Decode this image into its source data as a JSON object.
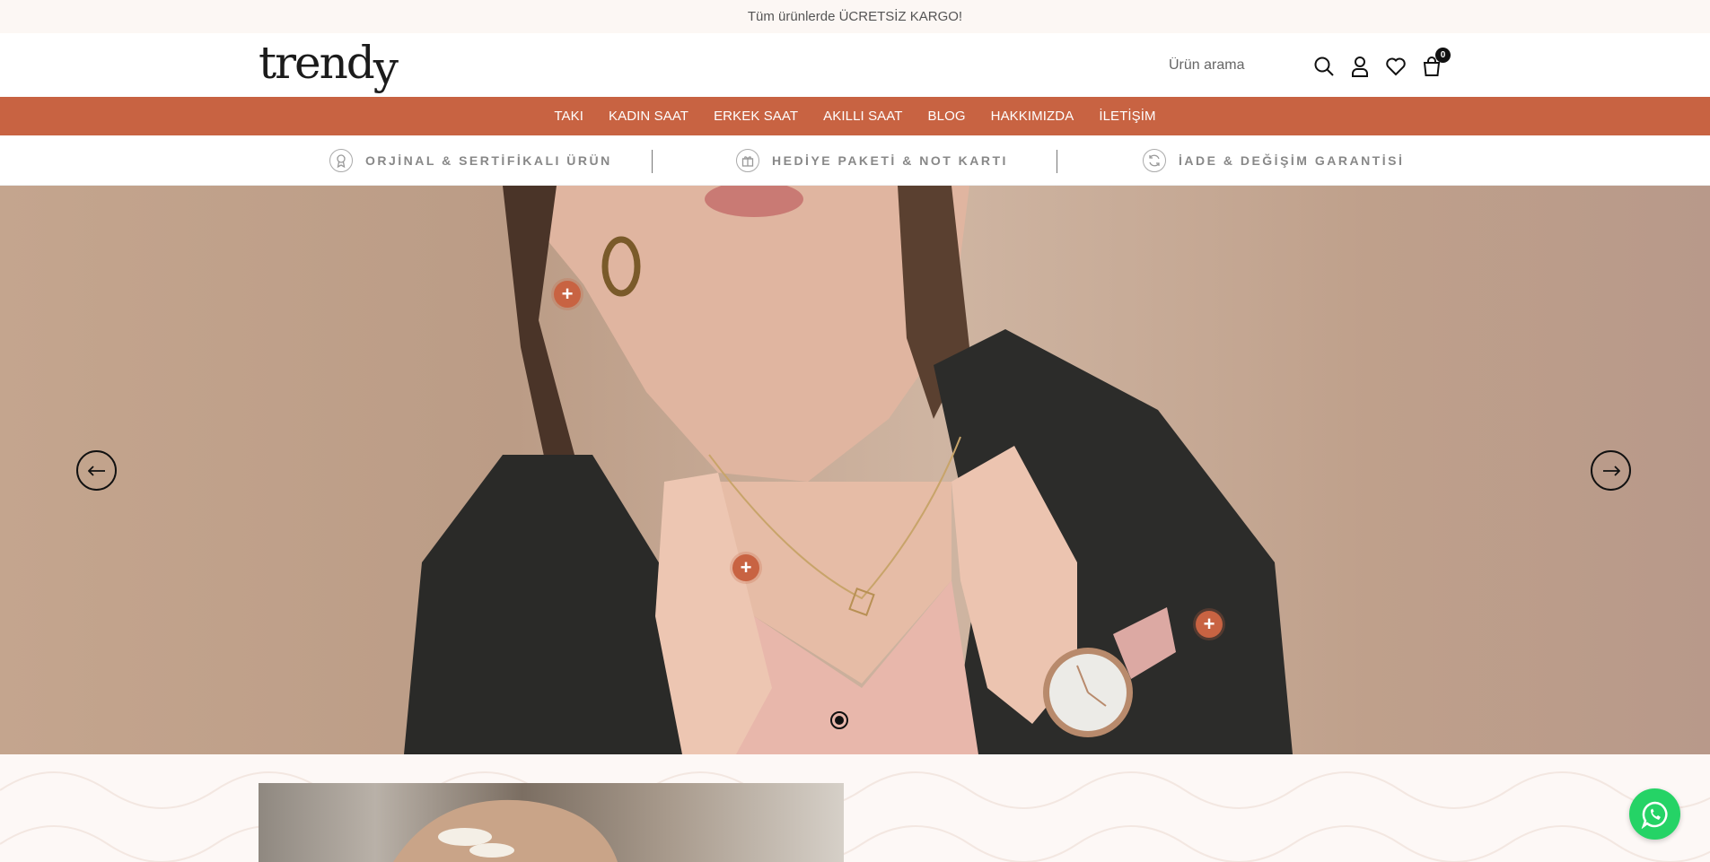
{
  "announcement": {
    "text": "Tüm ürünlerde ÜCRETSİZ KARGO!"
  },
  "header": {
    "logo": {
      "main": "trend",
      "tail": "y"
    },
    "search": {
      "placeholder": "Ürün arama",
      "value": ""
    },
    "icons": [
      "search-icon",
      "user-icon",
      "heart-icon",
      "cart-icon"
    ],
    "cart_count": "0"
  },
  "nav": {
    "items": [
      {
        "label": "TAKI"
      },
      {
        "label": "KADIN SAAT"
      },
      {
        "label": "ERKEK SAAT"
      },
      {
        "label": "AKILLI SAAT"
      },
      {
        "label": "BLOG"
      },
      {
        "label": "HAKKIMIZDA"
      },
      {
        "label": "İLETİŞİM"
      }
    ]
  },
  "features": {
    "items": [
      {
        "label": "ORJİNAL & SERTİFİKALI ÜRÜN",
        "icon": "certificate-icon"
      },
      {
        "label": "HEDİYE PAKETİ & NOT KARTI",
        "icon": "gift-icon"
      },
      {
        "label": "İADE & DEĞİŞİM GARANTİSİ",
        "icon": "refresh-icon"
      }
    ]
  },
  "hero": {
    "hotspot_symbol": "+",
    "active_slide": 1,
    "slide_count": 1
  },
  "colors": {
    "brand": "#c86342",
    "topbar_bg": "#fcf7f4",
    "whatsapp": "#25d366"
  }
}
